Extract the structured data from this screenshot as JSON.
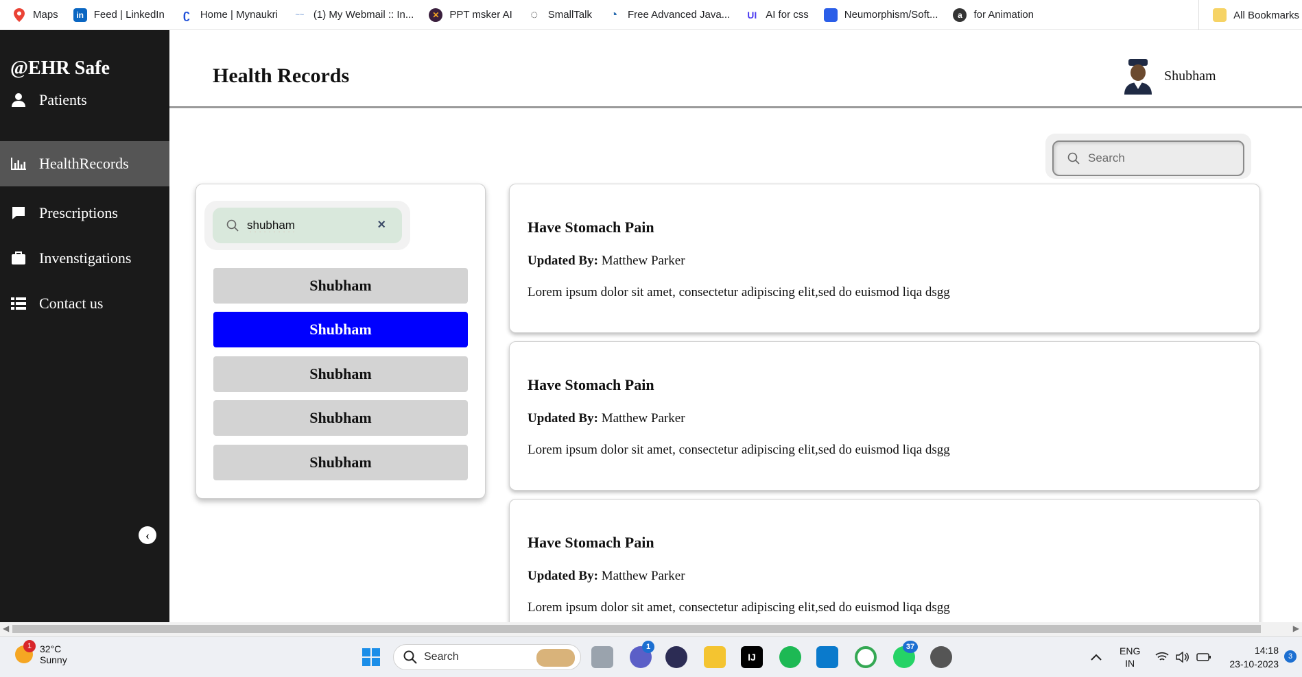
{
  "bookmarks": [
    {
      "label": "Maps",
      "icon": "maps-pin-icon",
      "color": "#34a853"
    },
    {
      "label": "Feed | LinkedIn",
      "icon": "linkedin-icon",
      "color": "#0a66c2"
    },
    {
      "label": "Home | Mynaukri",
      "icon": "naukri-icon",
      "color": "#1d4ed8"
    },
    {
      "label": "(1) My Webmail :: In...",
      "icon": "webmail-icon",
      "color": "#9ab6e0"
    },
    {
      "label": "PPT msker AI",
      "icon": "ppt-ai-icon",
      "color": "#3a1f3d"
    },
    {
      "label": "SmallTalk",
      "icon": "smalltalk-icon",
      "color": "#222222"
    },
    {
      "label": "Free Advanced Java...",
      "icon": "java-icon",
      "color": "#2b6cb0"
    },
    {
      "label": "AI for css",
      "icon": "ui-icon",
      "color": "#4c3cf0"
    },
    {
      "label": "Neumorphism/Soft...",
      "icon": "neumorphism-icon",
      "color": "#2b5ee8"
    },
    {
      "label": "for Animation",
      "icon": "animation-icon",
      "color": "#333333"
    }
  ],
  "bookmarks_all": "All Bookmarks",
  "sidebar": {
    "brand": "@EHR Safe",
    "items": [
      {
        "label": "Patients",
        "icon": "user-icon"
      },
      {
        "label": "HealthRecords",
        "icon": "bar-chart-icon"
      },
      {
        "label": "Prescriptions",
        "icon": "chat-icon"
      },
      {
        "label": "Invenstigations",
        "icon": "briefcase-icon"
      },
      {
        "label": "Contact us",
        "icon": "list-icon"
      }
    ],
    "active_index": 1,
    "collapse_icon": "chevron-left-icon"
  },
  "header": {
    "title": "Health Records",
    "user_name": "Shubham"
  },
  "global_search": {
    "placeholder": "Search"
  },
  "patient_search": {
    "value": "shubham",
    "clear_label": "×"
  },
  "patients": [
    {
      "name": "Shubham",
      "selected": false
    },
    {
      "name": "Shubham",
      "selected": true
    },
    {
      "name": "Shubham",
      "selected": false
    },
    {
      "name": "Shubham",
      "selected": false
    },
    {
      "name": "Shubham",
      "selected": false
    }
  ],
  "records": [
    {
      "title": "Have Stomach Pain",
      "updated_label": "Updated By:",
      "updated_by": "Matthew Parker",
      "body": "Lorem ipsum dolor sit amet, consectetur adipiscing elit,sed do euismod liqa dsgg"
    },
    {
      "title": "Have Stomach Pain",
      "updated_label": "Updated By:",
      "updated_by": "Matthew Parker",
      "body": "Lorem ipsum dolor sit amet, consectetur adipiscing elit,sed do euismod liqa dsgg"
    },
    {
      "title": "Have Stomach Pain",
      "updated_label": "Updated By:",
      "updated_by": "Matthew Parker",
      "body": "Lorem ipsum dolor sit amet, consectetur adipiscing elit,sed do euismod liqa dsgg"
    }
  ],
  "taskbar": {
    "weather_temp": "32°C",
    "weather_desc": "Sunny",
    "weather_badge": "1",
    "search_label": "Search",
    "teams_badge": "1",
    "whatsapp_badge": "37",
    "lang_1": "ENG",
    "lang_2": "IN",
    "time": "14:18",
    "date": "23-10-2023",
    "notif_badge": "3"
  }
}
